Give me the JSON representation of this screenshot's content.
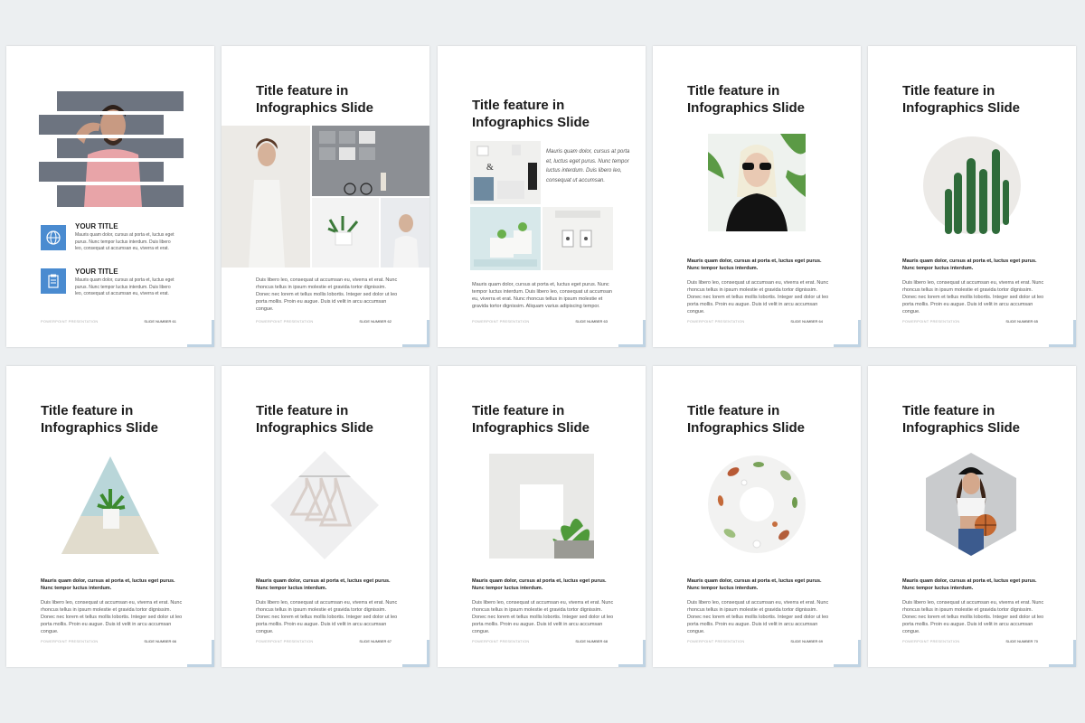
{
  "slides": [
    {
      "n": "SLIDE NUMBER 61",
      "footer_left": "POWERPOINT PRESENTATION",
      "items": [
        {
          "title": "YOUR TITLE",
          "text": "Mauris quam dolor, cursus at porta et, luctus eget purus. Nunc tempor luctus interdum. Duis libero leo, consequat ut accumsan eu, viverra et erat."
        },
        {
          "title": "YOUR TITLE",
          "text": "Mauris quam dolor, cursus at porta et, luctus eget purus. Nunc tempor luctus interdum. Duis libero leo, consequat ut accumsan eu, viverra et erat."
        }
      ]
    },
    {
      "n": "SLIDE NUMBER 62",
      "footer_left": "POWERPOINT PRESENTATION",
      "title": "Title feature in Infographics Slide",
      "body": "Duis libero leo, consequat ut accumsan eu, viverra et erat. Nunc rhoncus tellus in ipsum molestie et gravida tortor dignissim. Donec nec lorem et tellus mollis lobortis. Integer sed dolor ut leo porta mollis. Proin eu augue. Duis id velit in arcu accumsan congue."
    },
    {
      "n": "SLIDE NUMBER 63",
      "footer_left": "POWERPOINT PRESENTATION",
      "title": "Title feature in Infographics Slide",
      "quote": "Mauris quam dolor, cursus at porta et, luctus eget purus. Nunc tempor luctus interdum. Duis libero leo, consequat ut accumsan.",
      "body": "Mauris quam dolor, cursus at porta et, luctus eget purus. Nunc tempor luctus interdum. Duis libero leo, consequat ut accumsan eu, viverra et erat. Nunc rhoncus tellus in ipsum molestie et gravida tortor dignissim. Aliquam varius adipiscing tempor."
    },
    {
      "n": "SLIDE NUMBER 64",
      "footer_left": "POWERPOINT PRESENTATION",
      "title": "Title feature in Infographics Slide",
      "lead": "Mauris quam dolor, cursus at porta et, luctus eget purus. Nunc tempor luctus interdum.",
      "body": "Duis libero leo, consequat ut accumsan eu, viverra et erat. Nunc rhoncus tellus in ipsum molestie et gravida tortor dignissim. Donec nec lorem et tellus mollis lobortis. Integer sed dolor ut leo porta mollis. Proin eu augue. Duis id velit in arcu accumsan congue."
    },
    {
      "n": "SLIDE NUMBER 65",
      "footer_left": "POWERPOINT PRESENTATION",
      "title": "Title feature in Infographics Slide",
      "lead": "Mauris quam dolor, cursus at porta et, luctus eget purus. Nunc tempor luctus interdum.",
      "body": "Duis libero leo, consequat ut accumsan eu, viverra et erat. Nunc rhoncus tellus in ipsum molestie et gravida tortor dignissim. Donec nec lorem et tellus mollis lobortis. Integer sed dolor ut leo porta mollis. Proin eu augue. Duis id velit in arcu accumsan congue."
    },
    {
      "n": "SLIDE NUMBER 66",
      "footer_left": "POWERPOINT PRESENTATION",
      "title": "Title feature in Infographics Slide",
      "lead": "Mauris quam dolor, cursus at porta et, luctus eget purus. Nunc tempor luctus interdum.",
      "body": "Duis libero leo, consequat ut accumsan eu, viverra et erat. Nunc rhoncus tellus in ipsum molestie et gravida tortor dignissim. Donec nec lorem et tellus mollis lobortis. Integer sed dolor ut leo porta mollis. Proin eu augue. Duis id velit in arcu accumsan congue."
    },
    {
      "n": "SLIDE NUMBER 67",
      "footer_left": "POWERPOINT PRESENTATION",
      "title": "Title feature in Infographics Slide",
      "lead": "Mauris quam dolor, cursus at porta et, luctus eget purus. Nunc tempor luctus interdum.",
      "body": "Duis libero leo, consequat ut accumsan eu, viverra et erat. Nunc rhoncus tellus in ipsum molestie et gravida tortor dignissim. Donec nec lorem et tellus mollis lobortis. Integer sed dolor ut leo porta mollis. Proin eu augue. Duis id velit in arcu accumsan congue."
    },
    {
      "n": "SLIDE NUMBER 68",
      "footer_left": "POWERPOINT PRESENTATION",
      "title": "Title feature in Infographics Slide",
      "lead": "Mauris quam dolor, cursus at porta et, luctus eget purus. Nunc tempor luctus interdum.",
      "body": "Duis libero leo, consequat ut accumsan eu, viverra et erat. Nunc rhoncus tellus in ipsum molestie et gravida tortor dignissim. Donec nec lorem et tellus mollis lobortis. Integer sed dolor ut leo porta mollis. Proin eu augue. Duis id velit in arcu accumsan congue."
    },
    {
      "n": "SLIDE NUMBER 69",
      "footer_left": "POWERPOINT PRESENTATION",
      "title": "Title feature in Infographics Slide",
      "lead": "Mauris quam dolor, cursus at porta et, luctus eget purus. Nunc tempor luctus interdum.",
      "body": "Duis libero leo, consequat ut accumsan eu, viverra et erat. Nunc rhoncus tellus in ipsum molestie et gravida tortor dignissim. Donec nec lorem et tellus mollis lobortis. Integer sed dolor ut leo porta mollis. Proin eu augue. Duis id velit in arcu accumsan congue."
    },
    {
      "n": "SLIDE NUMBER 70",
      "footer_left": "POWERPOINT PRESENTATION",
      "title": "Title feature in Infographics Slide",
      "lead": "Mauris quam dolor, cursus at porta et, luctus eget purus. Nunc tempor luctus interdum.",
      "body": "Duis libero leo, consequat ut accumsan eu, viverra et erat. Nunc rhoncus tellus in ipsum molestie et gravida tortor dignissim. Donec nec lorem et tellus mollis lobortis. Integer sed dolor ut leo porta mollis. Proin eu augue. Duis id velit in arcu accumsan congue."
    }
  ],
  "colors": {
    "accent": "#4a8bd0",
    "corner": "#bfd3e3",
    "background": "#eceff1"
  }
}
